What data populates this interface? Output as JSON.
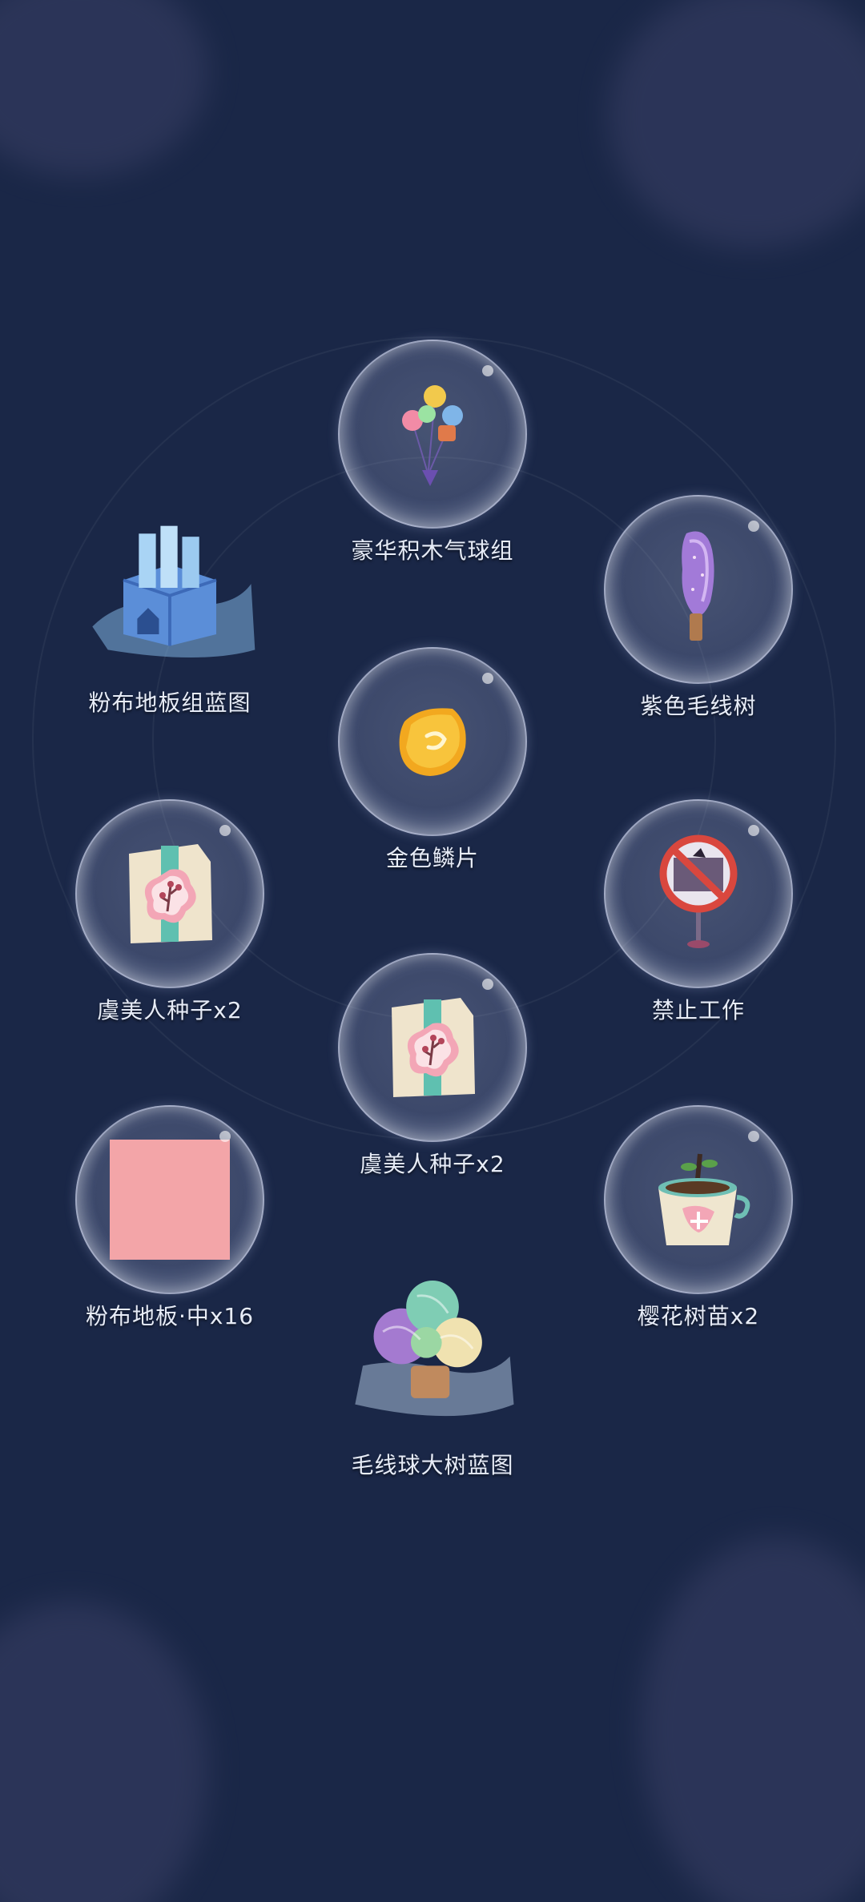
{
  "theme": {
    "background": "#1a2747",
    "cloud": "#3a4066",
    "label_color": "#e7ecf7"
  },
  "rewards": [
    {
      "label": "豪华积木气球组",
      "icon": "balloon-bunch-icon"
    },
    {
      "label": "粉布地板组蓝图",
      "icon": "blueprint-box-icon"
    },
    {
      "label": "紫色毛线树",
      "icon": "purple-yarn-tree-icon"
    },
    {
      "label": "金色鳞片",
      "icon": "gold-scale-icon"
    },
    {
      "label": "虞美人种子x2",
      "icon": "seed-packet-icon"
    },
    {
      "label": "禁止工作",
      "icon": "no-work-sign-icon"
    },
    {
      "label": "虞美人种子x2",
      "icon": "seed-packet-icon"
    },
    {
      "label": "粉布地板·中x16",
      "icon": "pink-floor-tile-icon"
    },
    {
      "label": "樱花树苗x2",
      "icon": "sakura-sapling-icon"
    },
    {
      "label": "毛线球大树蓝图",
      "icon": "yarn-tree-blueprint-icon"
    }
  ]
}
